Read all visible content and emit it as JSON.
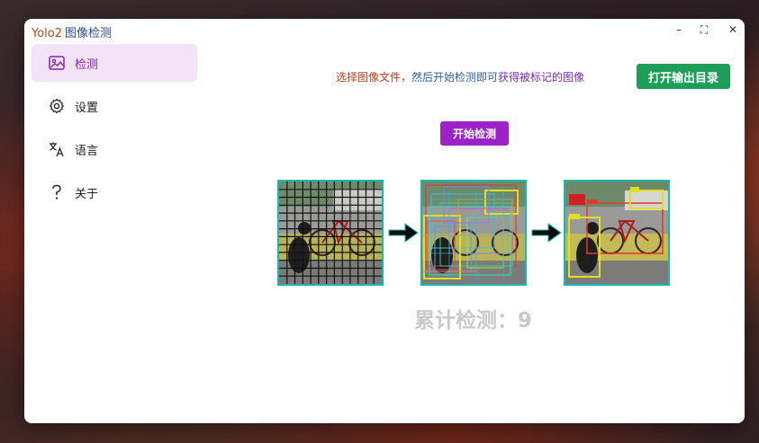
{
  "window": {
    "title_prefix": "Yolo2",
    "title_suffix": "图像检测",
    "controls": {
      "minimize": "–",
      "maximize": "⛶",
      "close": "✕"
    }
  },
  "sidebar": {
    "items": [
      {
        "label": "检测",
        "icon": "image-icon",
        "active": true
      },
      {
        "label": "设置",
        "icon": "gear-icon",
        "active": false
      },
      {
        "label": "语言",
        "icon": "translate-icon",
        "active": false
      },
      {
        "label": "关于",
        "icon": "question-icon",
        "active": false
      }
    ]
  },
  "main": {
    "hint": {
      "part1": "选择图像文件，",
      "part2": "然后开始检测即可",
      "part3": "获得被标记的图像"
    },
    "open_output_button": "打开输出目录",
    "start_button": "开始检测",
    "counter_label": "累计检测：",
    "counter_value": "9"
  },
  "colors": {
    "accent": "#9b22c9",
    "success": "#1e9e58",
    "active_nav_bg": "#f3e3f7",
    "panel_border": "#16b8b0"
  }
}
